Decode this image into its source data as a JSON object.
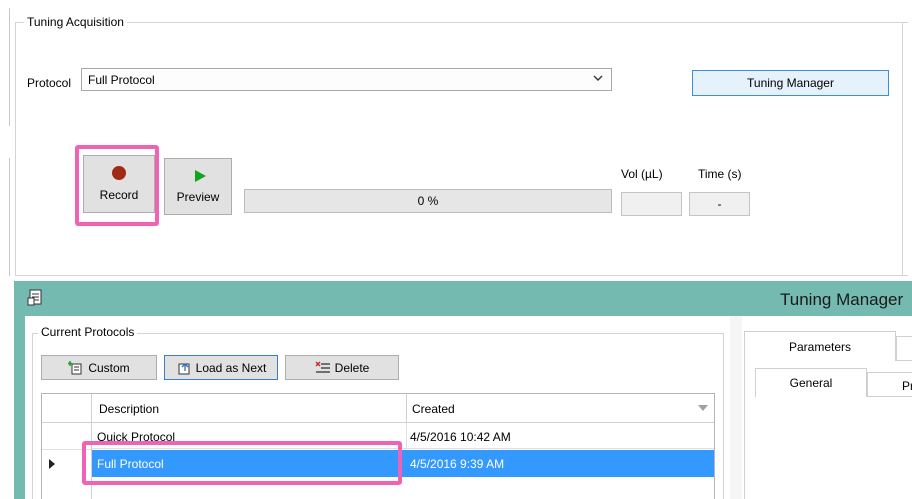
{
  "tuning_acquisition": {
    "group_title": "Tuning Acquisition",
    "protocol_label": "Protocol",
    "protocol_value": "Full Protocol",
    "tuning_manager_button": "Tuning Manager",
    "record_label": "Record",
    "preview_label": "Preview",
    "progress_text": "0 %",
    "progress_value": 0,
    "vol_label": "Vol (µL)",
    "time_label": "Time (s)",
    "vol_value": "",
    "time_value": "-"
  },
  "tuning_manager_window": {
    "title": "Tuning Manager",
    "current_protocols": {
      "group_title": "Current Protocols",
      "toolbar": {
        "custom": "Custom",
        "load_as_next": "Load as Next",
        "delete": "Delete"
      },
      "columns": [
        "Description",
        "Created"
      ],
      "rows": [
        {
          "description": "Quick Protocol",
          "created": "4/5/2016 10:42 AM",
          "selected": false
        },
        {
          "description": "Full Protocol",
          "created": "4/5/2016 9:39 AM",
          "selected": true
        }
      ]
    },
    "tabs": [
      "Parameters"
    ],
    "subtabs": [
      "General",
      "Pr"
    ]
  },
  "colors": {
    "highlight": "#ef62b5",
    "window_title_bg": "#74bab1",
    "selection": "#3399ff",
    "record_dot": "#a12a14",
    "play_icon": "#14a31e"
  }
}
